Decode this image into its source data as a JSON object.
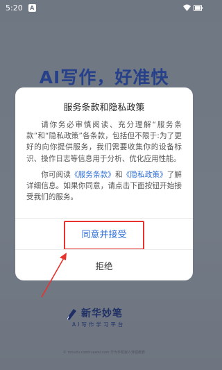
{
  "status_bar": {
    "time": "5:20",
    "notification_letter": "A"
  },
  "background": {
    "slogan": "AI写作，好准快",
    "logo_name": "新华妙笔",
    "logo_subtitle": "AI写作学习平台",
    "watermark": "© mnudu.comhuawei.com 华为手机家人伴侣教育"
  },
  "dialog": {
    "title": "服务条款和隐私政策",
    "paragraph1": "请你务必审慎阅读、充分理解“服务条款”和“隐私政策”各条款，包括但不限于:为了更好的向你提供服务，我们需要收集你的设备标识、操作日志等信息用于分析、优化应用性能。",
    "p2_before": "你可阅读",
    "terms_link": "《服务条款》",
    "p2_and": "和",
    "privacy_link": "《隐私政策》",
    "p2_after": "了解详细信息。如果你同意，请点击下面按钮开始接受我们的服务。",
    "agree_label": "同意并接受",
    "reject_label": "拒绝"
  },
  "colors": {
    "accent_blue": "#2f6fd6",
    "highlight_red": "#e8322d",
    "slogan_blue": "#27408a"
  }
}
